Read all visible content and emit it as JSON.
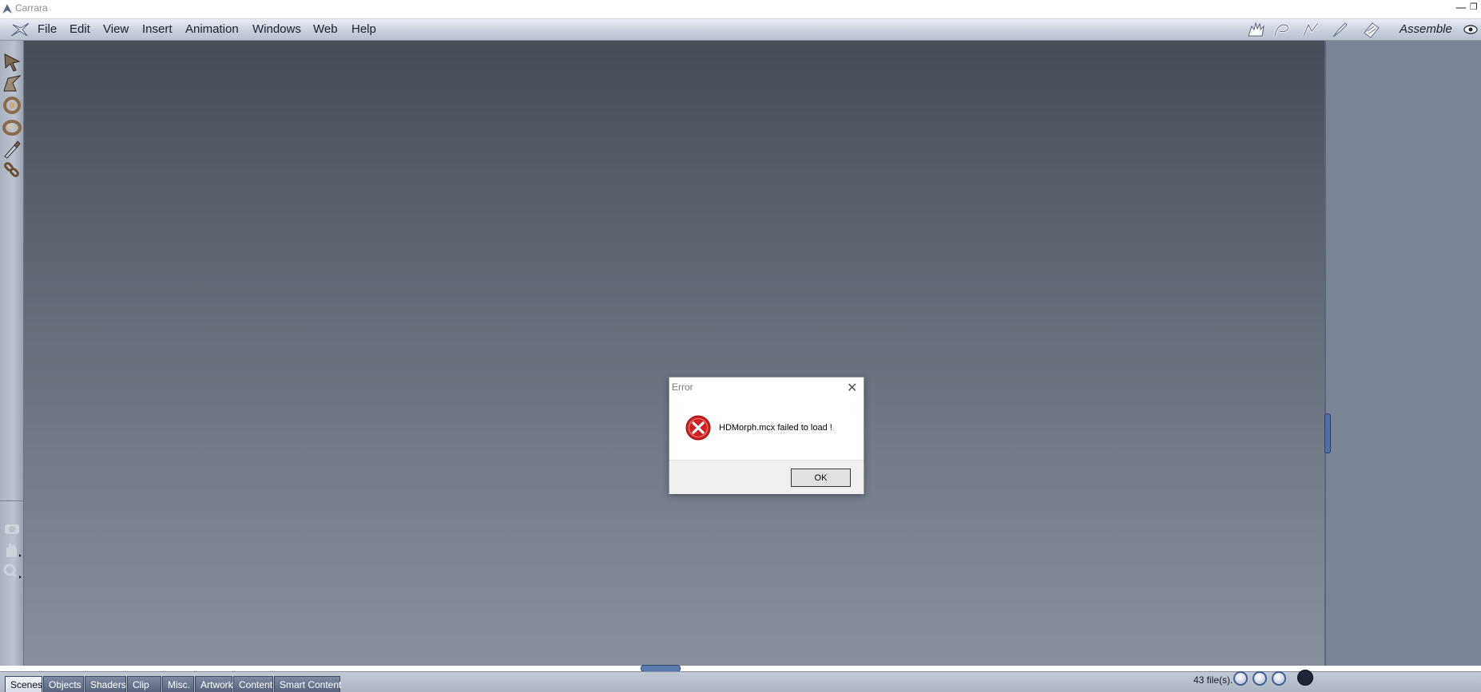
{
  "window": {
    "title": "Carrara"
  },
  "menubar": {
    "items": [
      "File",
      "Edit",
      "View",
      "Insert",
      "Animation",
      "Windows",
      "Web",
      "Help"
    ],
    "room": "Assemble"
  },
  "bottom_tabs": [
    "Scenes",
    "Objects",
    "Shaders",
    "Clip",
    "Misc.",
    "Artwork",
    "Content",
    "Smart Content"
  ],
  "status": {
    "file_count": "43 file(s)."
  },
  "dialog": {
    "title": "Error",
    "message": "HDMorph.mcx failed to load !",
    "ok_label": "OK"
  },
  "colors": {
    "viewport_top": "#474d57",
    "viewport_bottom": "#868e9c",
    "error_red": "#d11f1f",
    "panel_handle_blue": "#4f6ea3"
  },
  "icons": {
    "room_icons": [
      "assemble-hand-icon",
      "model-icon",
      "storyboard-icon",
      "texture-icon",
      "render-icon"
    ],
    "tools": [
      "select-arrow-icon",
      "move-arrow-icon",
      "rotate-icon",
      "spin-icon",
      "eyedropper-icon",
      "link-icon"
    ]
  }
}
